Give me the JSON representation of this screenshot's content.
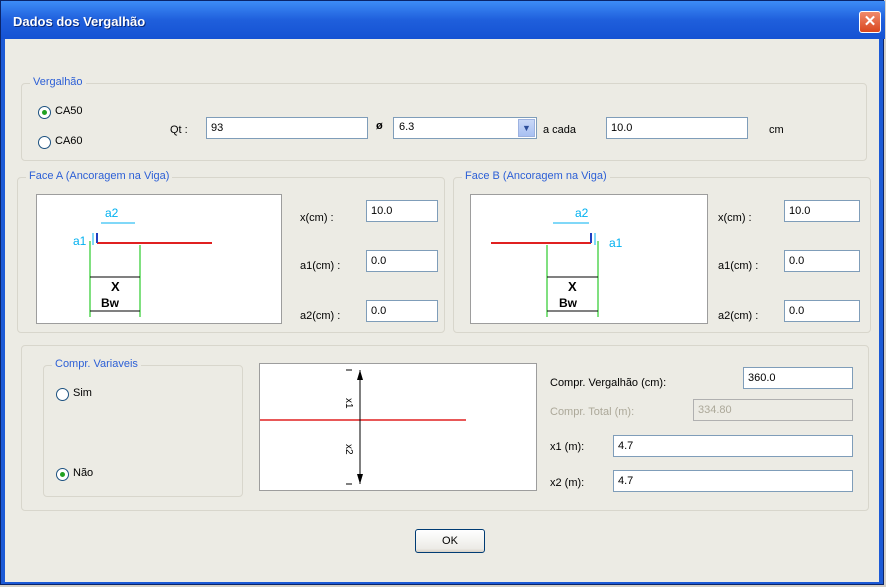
{
  "window": {
    "title": "Dados dos Vergalhão"
  },
  "vergalhao": {
    "legend": "Vergalhão",
    "options": [
      {
        "label": "CA50",
        "selected": true
      },
      {
        "label": "CA60",
        "selected": false
      }
    ],
    "qt_label": "Qt :",
    "qt_value": "93",
    "diameter_symbol": "ø",
    "diameter_value": "6.3",
    "a_cada_label": "a cada",
    "a_cada_value": "10.0",
    "unit": "cm"
  },
  "face_a": {
    "legend": "Face A (Ancoragem na Viga)",
    "x_label": "x(cm) :",
    "x_value": "10.0",
    "a1_label": "a1(cm) :",
    "a1_value": "0.0",
    "a2_label": "a2(cm) :",
    "a2_value": "0.0",
    "diagram": {
      "a1": "a1",
      "a2": "a2",
      "x": "X",
      "bw": "Bw"
    }
  },
  "face_b": {
    "legend": "Face B (Ancoragem na Viga)",
    "x_label": "x(cm) :",
    "x_value": "10.0",
    "a1_label": "a1(cm) :",
    "a1_value": "0.0",
    "a2_label": "a2(cm) :",
    "a2_value": "0.0",
    "diagram": {
      "a1": "a1",
      "a2": "a2",
      "x": "X",
      "bw": "Bw"
    }
  },
  "comprimento": {
    "legend": "Compr. Variaveis",
    "options": [
      {
        "label": "Sim",
        "selected": false
      },
      {
        "label": "Não",
        "selected": true
      }
    ],
    "diagram": {
      "x1": "x1",
      "x2": "x2"
    },
    "compr_vergalhao_label": "Compr. Vergalhão (cm):",
    "compr_vergalhao_value": "360.0",
    "compr_total_label": "Compr. Total (m):",
    "compr_total_value": "334.80",
    "x1_label": "x1 (m):",
    "x1_value": "4.7",
    "x2_label": "x2 (m):",
    "x2_value": "4.7"
  },
  "ok_label": "OK",
  "colors": {
    "rebar": "#e02020",
    "dimension_blue": "#00b0f0",
    "dimension_green": "#00c000",
    "legend": "#2c5fd6"
  }
}
